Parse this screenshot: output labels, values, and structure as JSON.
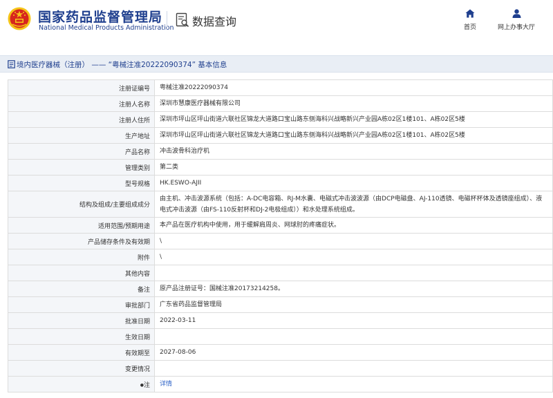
{
  "header": {
    "brand_cn": "国家药品监督管理局",
    "brand_en": "National Medical Products Administration",
    "query_title": "数据查询",
    "nav": [
      {
        "label": "首页",
        "icon": "home-icon"
      },
      {
        "label": "网上办事大厅",
        "icon": "user-icon"
      }
    ]
  },
  "title_bar": {
    "text": "境内医疗器械（注册） —— “粤械注准20222090374” 基本信息",
    "icon": "document-icon"
  },
  "rows": [
    {
      "label": "注册证编号",
      "value": "粤械注准20222090374"
    },
    {
      "label": "注册人名称",
      "value": "深圳市慧康医疗器械有限公司"
    },
    {
      "label": "注册人住所",
      "value": "深圳市坪山区坪山街道六联社区锦龙大道路口宝山路东侧海科兴战略新兴产业园A栋02区1楼101、A栋02区5楼"
    },
    {
      "label": "生产地址",
      "value": "深圳市坪山区坪山街道六联社区锦龙大道路口宝山路东侧海科兴战略新兴产业园A栋02区1楼101、A栋02区5楼"
    },
    {
      "label": "产品名称",
      "value": "冲击波骨科治疗机"
    },
    {
      "label": "管理类别",
      "value": "第二类"
    },
    {
      "label": "型号规格",
      "value": "HK.ESWO-AJII"
    },
    {
      "label": "结构及组成/主要组成成分",
      "value": "由主机、冲击波源系统（包括：A-DC电容箱、RJ-M水囊、电磁式冲击波波源（由DCP电磁盘、AJ-110透镜、电磁杯杯体及透镜座组成）、液电式冲击波源（由FS-110反射杯和DJ-2电极组成））和水处理系统组成。"
    },
    {
      "label": "适用范围/预期用途",
      "value": "本产品在医疗机构中使用，用于缓解肩周炎、网球肘的疼痛症状。"
    },
    {
      "label": "产品储存条件及有效期",
      "value": "\\"
    },
    {
      "label": "附件",
      "value": "\\"
    },
    {
      "label": "其他内容",
      "value": ""
    },
    {
      "label": "备注",
      "value": "原产品注册证号：国械注准20173214258。"
    },
    {
      "label": "审批部门",
      "value": "广东省药品监督管理局"
    },
    {
      "label": "批准日期",
      "value": "2022-03-11"
    },
    {
      "label": "生效日期",
      "value": ""
    },
    {
      "label": "有效期至",
      "value": "2027-08-06"
    },
    {
      "label": "变更情况",
      "value": ""
    },
    {
      "label": "注",
      "value": "详情",
      "bullet": "●"
    }
  ],
  "colors": {
    "brand_blue": "#1f3f8e",
    "emblem_red": "#d7261e",
    "emblem_gold": "#f5c518",
    "link_blue": "#2e63c7",
    "label_bg": "#f4f6f9",
    "title_bar_bg": "#e9eef5"
  }
}
